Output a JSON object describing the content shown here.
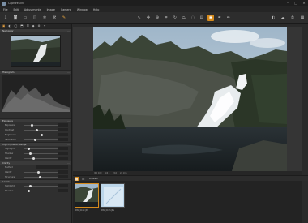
{
  "app": {
    "title": "Capture One"
  },
  "window_controls": [
    "–",
    "□",
    "✕"
  ],
  "menu": [
    "File",
    "Edit",
    "Adjustments",
    "Image",
    "Camera",
    "Window",
    "Help"
  ],
  "toolbar": {
    "left_icons": [
      "import-icon",
      "camera-icon",
      "folder-icon",
      "tools-icon",
      "settings-icon",
      "wrench-icon",
      "brush-icon"
    ],
    "center_icons": [
      "pointer-icon",
      "pan-icon",
      "zoom-icon",
      "crop-icon",
      "rotate-icon",
      "keystone-icon",
      "spot-icon",
      "select-icon",
      "loupe-icon",
      "picker-icon",
      "pen-icon"
    ],
    "center_active_index": 8,
    "right_icons": [
      "proof-icon",
      "cloud-icon",
      "print-icon",
      "grid-icon"
    ],
    "accent": "#d58a1c"
  },
  "left_panel": {
    "tabs": [
      "▣",
      "◐",
      "◯",
      "⬒",
      "☰",
      "◆",
      "⚙",
      "✦"
    ],
    "navigator": {
      "label": "Navigator"
    },
    "histogram": {
      "label": "Histogram"
    },
    "exposure_section": {
      "label": "Exposure",
      "rows": [
        "Exposure",
        "Contrast",
        "Brightness",
        "Saturation"
      ]
    },
    "hdr_section": {
      "label": "High Dynamic Range",
      "rows": [
        "Highlight",
        "Shadow",
        "Clarity"
      ]
    },
    "clarity_section": {
      "label": "Clarity",
      "rows": [
        "Method",
        "Clarity",
        "Structure"
      ]
    },
    "levels_section": {
      "label": "Levels",
      "rows": [
        "Highlight",
        "Shadow"
      ]
    }
  },
  "browser": {
    "label": "Browser",
    "thumbs": [
      {
        "caption": "IMG_0412.JPG",
        "selected": true
      },
      {
        "caption": "IMG_0413.JPG",
        "selected": false
      }
    ]
  },
  "viewer": {
    "status": [
      "ISO 100",
      "1/4 s",
      "f/16",
      "24 mm"
    ]
  }
}
